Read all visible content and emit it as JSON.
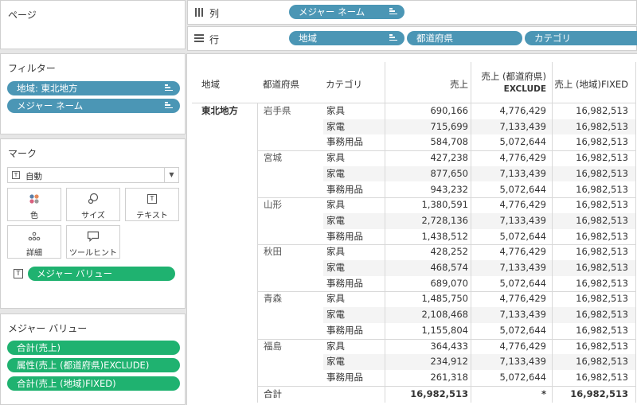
{
  "pages_card": {
    "title": "ページ"
  },
  "filters_card": {
    "title": "フィルター",
    "pills": [
      {
        "label": "地域: 東北地方"
      },
      {
        "label": "メジャー ネーム"
      }
    ]
  },
  "marks_card": {
    "title": "マーク",
    "mark_type": "自動",
    "buttons": [
      {
        "label": "色",
        "icon": "color-dots-icon"
      },
      {
        "label": "サイズ",
        "icon": "size-icon"
      },
      {
        "label": "テキスト",
        "icon": "text-icon"
      },
      {
        "label": "詳細",
        "icon": "detail-dots-icon"
      },
      {
        "label": "ツールヒント",
        "icon": "tooltip-icon"
      }
    ],
    "text_pill": "メジャー バリュー"
  },
  "measure_values_card": {
    "title": "メジャー バリュー",
    "pills": [
      {
        "label": "合計(売上)"
      },
      {
        "label": "属性(売上 (都道府県)EXCLUDE)"
      },
      {
        "label": "合計(売上 (地域)FIXED)"
      }
    ]
  },
  "columns_shelf": {
    "label": "列",
    "pills": [
      {
        "label": "メジャー ネーム"
      }
    ]
  },
  "rows_shelf": {
    "label": "行",
    "pills": [
      {
        "label": "地域"
      },
      {
        "label": "都道府県"
      },
      {
        "label": "カテゴリ"
      }
    ]
  },
  "table": {
    "headers": {
      "region": "地域",
      "prefecture": "都道府県",
      "category": "カテゴリ",
      "sales": "売上",
      "excl_line1": "売上 (都道府県)",
      "excl_line2": "EXCLUDE",
      "fixed": "売上 (地域)FIXED"
    },
    "region": "東北地方",
    "groups": [
      {
        "prefecture": "岩手県",
        "rows": [
          {
            "category": "家具",
            "sales": "690,166",
            "excl": "4,776,429",
            "fixed": "16,982,513"
          },
          {
            "category": "家電",
            "sales": "715,699",
            "excl": "7,133,439",
            "fixed": "16,982,513"
          },
          {
            "category": "事務用品",
            "sales": "584,708",
            "excl": "5,072,644",
            "fixed": "16,982,513"
          }
        ]
      },
      {
        "prefecture": "宮城",
        "rows": [
          {
            "category": "家具",
            "sales": "427,238",
            "excl": "4,776,429",
            "fixed": "16,982,513"
          },
          {
            "category": "家電",
            "sales": "877,650",
            "excl": "7,133,439",
            "fixed": "16,982,513"
          },
          {
            "category": "事務用品",
            "sales": "943,232",
            "excl": "5,072,644",
            "fixed": "16,982,513"
          }
        ]
      },
      {
        "prefecture": "山形",
        "rows": [
          {
            "category": "家具",
            "sales": "1,380,591",
            "excl": "4,776,429",
            "fixed": "16,982,513"
          },
          {
            "category": "家電",
            "sales": "2,728,136",
            "excl": "7,133,439",
            "fixed": "16,982,513"
          },
          {
            "category": "事務用品",
            "sales": "1,438,512",
            "excl": "5,072,644",
            "fixed": "16,982,513"
          }
        ]
      },
      {
        "prefecture": "秋田",
        "rows": [
          {
            "category": "家具",
            "sales": "428,252",
            "excl": "4,776,429",
            "fixed": "16,982,513"
          },
          {
            "category": "家電",
            "sales": "468,574",
            "excl": "7,133,439",
            "fixed": "16,982,513"
          },
          {
            "category": "事務用品",
            "sales": "689,070",
            "excl": "5,072,644",
            "fixed": "16,982,513"
          }
        ]
      },
      {
        "prefecture": "青森",
        "rows": [
          {
            "category": "家具",
            "sales": "1,485,750",
            "excl": "4,776,429",
            "fixed": "16,982,513"
          },
          {
            "category": "家電",
            "sales": "2,108,468",
            "excl": "7,133,439",
            "fixed": "16,982,513"
          },
          {
            "category": "事務用品",
            "sales": "1,155,804",
            "excl": "5,072,644",
            "fixed": "16,982,513"
          }
        ]
      },
      {
        "prefecture": "福島",
        "rows": [
          {
            "category": "家具",
            "sales": "364,433",
            "excl": "4,776,429",
            "fixed": "16,982,513"
          },
          {
            "category": "家電",
            "sales": "234,912",
            "excl": "7,133,439",
            "fixed": "16,982,513"
          },
          {
            "category": "事務用品",
            "sales": "261,318",
            "excl": "5,072,644",
            "fixed": "16,982,513"
          }
        ]
      }
    ],
    "total": {
      "label": "合計",
      "sales": "16,982,513",
      "excl": "*",
      "fixed": "16,982,513"
    }
  },
  "colors": {
    "dimension_pill": "#4b96b5",
    "measure_pill": "#1fb270",
    "band": "#f4f4f4"
  }
}
